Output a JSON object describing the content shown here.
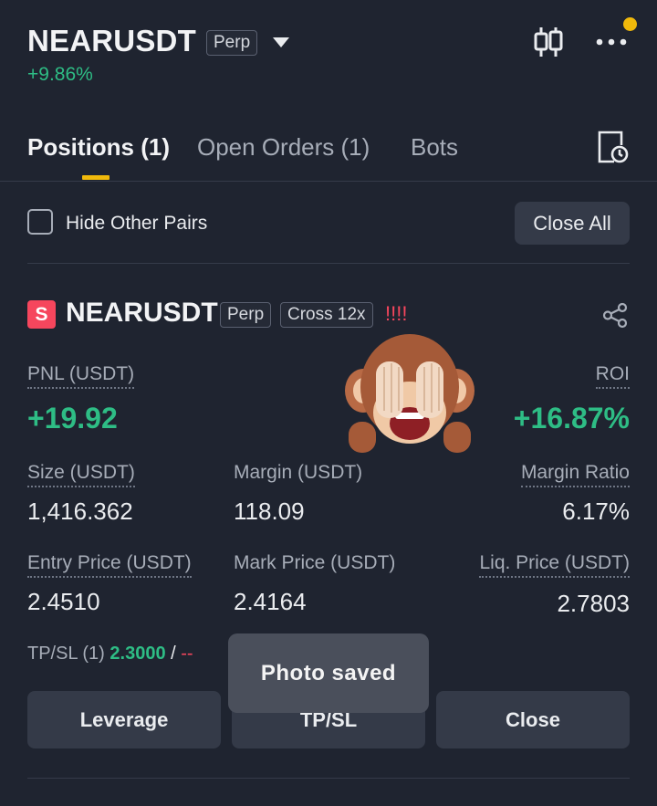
{
  "header": {
    "symbol": "NEARUSDT",
    "type_tag": "Perp",
    "change": "+9.86%"
  },
  "tabs": [
    {
      "label": "Positions (1)",
      "active": true
    },
    {
      "label": "Open Orders (1)",
      "active": false
    },
    {
      "label": "Bots",
      "active": false
    }
  ],
  "filter": {
    "hide_other_pairs_label": "Hide Other Pairs",
    "hide_other_pairs_checked": false,
    "close_all_label": "Close All"
  },
  "position": {
    "side_badge": "S",
    "symbol": "NEARUSDT",
    "type_tag": "Perp",
    "margin_tag": "Cross 12x",
    "warning": "!!!!",
    "pnl_label": "PNL (USDT)",
    "pnl_value": "+19.92",
    "roi_label": "ROI",
    "roi_value": "+16.87%",
    "size_label": "Size (USDT)",
    "size_value": "1,416.362",
    "margin_label": "Margin (USDT)",
    "margin_value": "118.09",
    "margin_ratio_label": "Margin Ratio",
    "margin_ratio_value": "6.17%",
    "entry_label": "Entry Price (USDT)",
    "entry_value": "2.4510",
    "mark_label": "Mark Price (USDT)",
    "mark_value": "2.4164",
    "liq_label": "Liq. Price (USDT)",
    "liq_value": "2.7803",
    "tpsl_label": "TP/SL (1)",
    "tp_value": "2.3000",
    "tpsl_sep": "/",
    "sl_value": "--"
  },
  "actions": {
    "leverage": "Leverage",
    "tpsl": "TP/SL",
    "close": "Close"
  },
  "toast": {
    "text": "Photo saved"
  },
  "colors": {
    "background": "#1f2430",
    "green": "#2ebd85",
    "red": "#f6465d",
    "accent_yellow": "#f0b90b"
  }
}
